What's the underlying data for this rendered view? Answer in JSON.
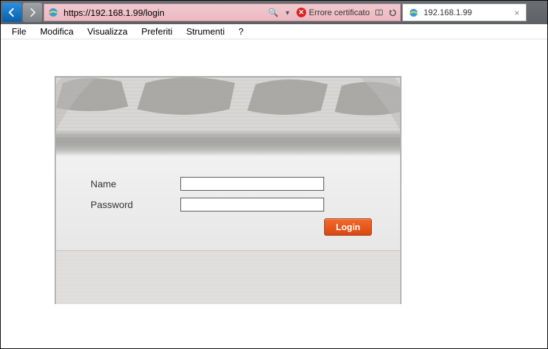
{
  "address_bar": {
    "url": "https://192.168.1.99/login",
    "cert_error_label": "Errore certificato"
  },
  "tab": {
    "title": "192.168.1.99"
  },
  "menubar": {
    "file": "File",
    "modifica": "Modifica",
    "visualizza": "Visualizza",
    "preferiti": "Preferiti",
    "strumenti": "Strumenti",
    "help": "?"
  },
  "login_form": {
    "name_label": "Name",
    "password_label": "Password",
    "name_value": "",
    "password_value": "",
    "login_button_label": "Login"
  }
}
